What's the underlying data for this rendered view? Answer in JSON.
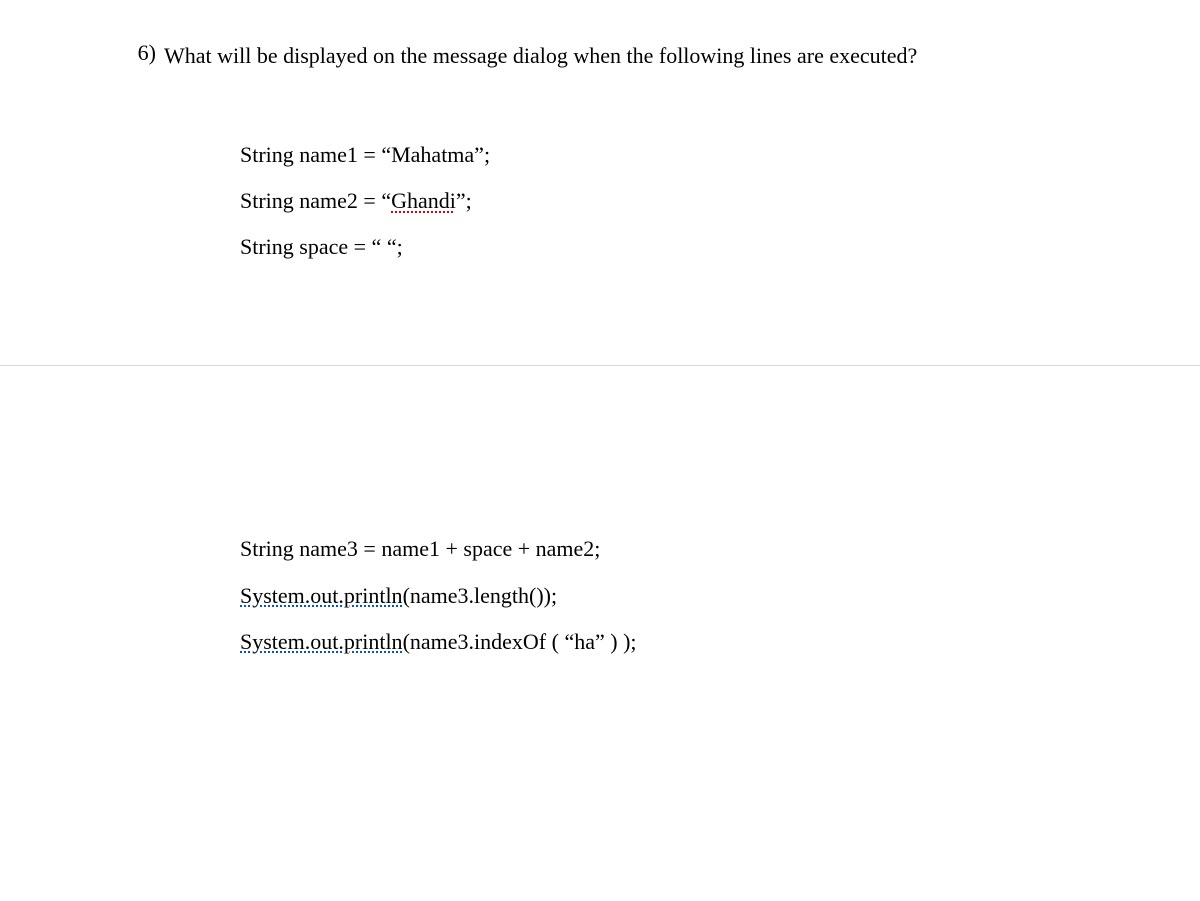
{
  "question": {
    "number": "6)",
    "text": "What will be displayed on the message dialog when the following lines are executed?"
  },
  "code": {
    "line1_pre": "String name1 = “Mahatma”;",
    "line2_pre": "String name2 = “",
    "line2_wavy": "Ghandi",
    "line2_post": "”;",
    "line3": "String space = “  “;",
    "line4": "String name3 = name1 + space + name2;",
    "line5_wavy": "System.out.println",
    "line5_post": "(name3.length());",
    "line6_wavy": "System.out.println",
    "line6_post": "(name3.indexOf ( “ha” ) );"
  }
}
